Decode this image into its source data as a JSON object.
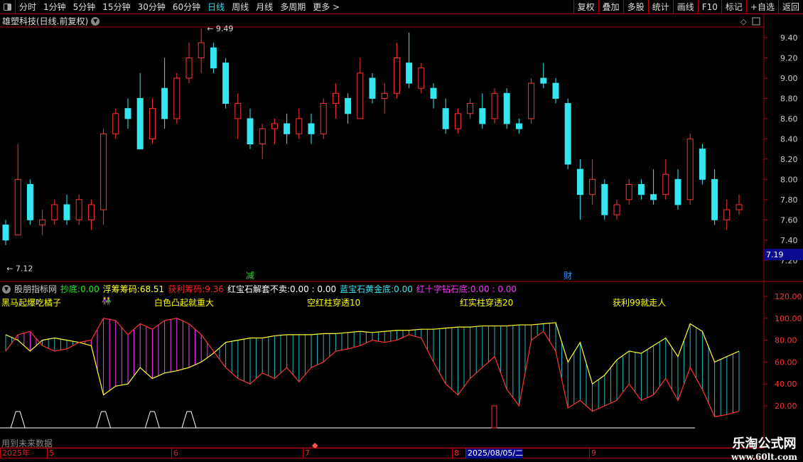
{
  "toolbar": {
    "periods": [
      "分时",
      "1分钟",
      "5分钟",
      "15分钟",
      "30分钟",
      "60分钟",
      "日线",
      "周线",
      "月线",
      "多周期",
      "更多 >"
    ],
    "active": "日线",
    "buttons": [
      "复权",
      "叠加",
      "多股",
      "统计",
      "画线",
      "F10",
      "标记",
      "+自选",
      "返回"
    ]
  },
  "title": "雄塑科技(日线.前复权)",
  "price_axis": {
    "ticks": [
      "9.40",
      "9.20",
      "9.00",
      "8.80",
      "8.60",
      "8.40",
      "8.20",
      "8.00",
      "7.80",
      "7.60",
      "7.40",
      "7.20"
    ],
    "current": "7.19",
    "high_label": "9.49",
    "low_label": "7.12"
  },
  "markers": [
    {
      "text": "减",
      "color": "#22dd22",
      "bar": 20
    },
    {
      "text": "财",
      "color": "#3399ff",
      "bar": 46
    }
  ],
  "colors": {
    "up": "#ff3333",
    "down": "#33e6f0",
    "yellow": "#ffff33",
    "magenta": "#ff33ff",
    "grid_border": "#b00000"
  },
  "candles": [
    [
      7.55,
      7.6,
      7.35,
      7.4
    ],
    [
      7.45,
      8.35,
      7.45,
      8.0
    ],
    [
      7.95,
      8.0,
      7.55,
      7.6
    ],
    [
      7.55,
      7.7,
      7.45,
      7.6
    ],
    [
      7.6,
      7.8,
      7.55,
      7.75
    ],
    [
      7.75,
      7.85,
      7.55,
      7.6
    ],
    [
      7.6,
      7.85,
      7.55,
      7.8
    ],
    [
      7.6,
      7.8,
      7.5,
      7.75
    ],
    [
      7.7,
      8.5,
      7.55,
      8.45
    ],
    [
      8.45,
      8.7,
      8.4,
      8.65
    ],
    [
      8.7,
      8.8,
      8.5,
      8.6
    ],
    [
      8.8,
      9.05,
      8.3,
      8.3
    ],
    [
      8.4,
      8.8,
      8.35,
      8.7
    ],
    [
      8.9,
      9.2,
      8.5,
      8.6
    ],
    [
      8.6,
      9.05,
      8.55,
      9.0
    ],
    [
      9.0,
      9.35,
      8.95,
      9.2
    ],
    [
      9.2,
      9.49,
      9.05,
      9.35
    ],
    [
      9.3,
      9.35,
      9.05,
      9.1
    ],
    [
      9.15,
      9.2,
      8.7,
      8.75
    ],
    [
      8.6,
      8.85,
      8.4,
      8.75
    ],
    [
      8.6,
      8.7,
      8.3,
      8.35
    ],
    [
      8.35,
      8.55,
      8.2,
      8.5
    ],
    [
      8.5,
      8.6,
      8.35,
      8.55
    ],
    [
      8.55,
      8.65,
      8.35,
      8.45
    ],
    [
      8.45,
      8.7,
      8.4,
      8.6
    ],
    [
      8.55,
      8.65,
      8.35,
      8.45
    ],
    [
      8.45,
      8.8,
      8.4,
      8.75
    ],
    [
      8.75,
      8.95,
      8.6,
      8.85
    ],
    [
      8.8,
      8.85,
      8.55,
      8.65
    ],
    [
      8.6,
      9.2,
      8.6,
      9.05
    ],
    [
      9.0,
      9.05,
      8.75,
      8.8
    ],
    [
      8.8,
      8.95,
      8.65,
      8.85
    ],
    [
      8.85,
      9.35,
      8.8,
      9.2
    ],
    [
      9.15,
      9.45,
      8.9,
      8.95
    ],
    [
      8.9,
      9.15,
      8.85,
      9.1
    ],
    [
      8.9,
      8.95,
      8.7,
      8.8
    ],
    [
      8.7,
      8.8,
      8.45,
      8.5
    ],
    [
      8.5,
      8.7,
      8.45,
      8.65
    ],
    [
      8.65,
      8.8,
      8.6,
      8.75
    ],
    [
      8.7,
      8.85,
      8.5,
      8.55
    ],
    [
      8.6,
      8.9,
      8.55,
      8.85
    ],
    [
      8.85,
      8.9,
      8.5,
      8.55
    ],
    [
      8.55,
      8.6,
      8.45,
      8.5
    ],
    [
      8.6,
      9.0,
      8.55,
      8.95
    ],
    [
      9.0,
      9.15,
      8.9,
      8.95
    ],
    [
      8.95,
      9.0,
      8.75,
      8.8
    ],
    [
      8.75,
      8.8,
      8.1,
      8.15
    ],
    [
      8.1,
      8.2,
      7.6,
      7.85
    ],
    [
      7.85,
      8.2,
      7.75,
      8.0
    ],
    [
      7.95,
      8.0,
      7.6,
      7.65
    ],
    [
      7.65,
      7.8,
      7.6,
      7.75
    ],
    [
      7.8,
      8.0,
      7.75,
      7.95
    ],
    [
      7.95,
      8.0,
      7.8,
      7.85
    ],
    [
      7.85,
      8.1,
      7.75,
      7.8
    ],
    [
      7.85,
      8.2,
      7.8,
      8.05
    ],
    [
      8.0,
      8.1,
      7.7,
      7.75
    ],
    [
      7.8,
      8.45,
      7.75,
      8.4
    ],
    [
      8.3,
      8.35,
      7.95,
      8.0
    ],
    [
      8.0,
      8.1,
      7.55,
      7.6
    ],
    [
      7.6,
      7.8,
      7.5,
      7.7
    ],
    [
      7.7,
      7.85,
      7.65,
      7.75
    ]
  ],
  "indicator": {
    "name": "股朋指标网",
    "values": [
      {
        "label": "抄底:",
        "value": "0.00",
        "color": "#22ee22"
      },
      {
        "label": "浮筹筹码:",
        "value": "68.51",
        "color": "#ffff33"
      },
      {
        "label": "获利筹码:",
        "value": "9.36",
        "color": "#ff2222"
      },
      {
        "label": "红宝石解套不卖:",
        "value": "0.00 : 0.00",
        "color": "#ffffff"
      },
      {
        "label": "蓝宝石黄金底:",
        "value": "0.00",
        "color": "#33e6f0"
      },
      {
        "label": "红十字钻石底:",
        "value": "0.00 : 0.00",
        "color": "#ff33ff"
      }
    ],
    "labels": [
      "黑马起爆吃橘子",
      "白色凸起就重大",
      "空红柱穿透10",
      "红实柱穿透20",
      "获利99就走人"
    ],
    "axis_ticks": [
      "120.00",
      "100.00",
      "80.00",
      "60.00",
      "40.00",
      "20.00"
    ],
    "yellow": [
      85,
      80,
      70,
      80,
      82,
      80,
      78,
      75,
      30,
      38,
      40,
      55,
      45,
      50,
      52,
      55,
      60,
      68,
      78,
      80,
      82,
      82,
      84,
      85,
      85,
      85,
      86,
      86,
      87,
      88,
      87,
      88,
      89,
      89,
      90,
      90,
      91,
      92,
      92,
      93,
      93,
      93,
      94,
      94,
      95,
      96,
      60,
      78,
      40,
      48,
      62,
      70,
      68,
      75,
      82,
      65,
      95,
      88,
      60,
      65,
      70
    ],
    "red": [
      70,
      85,
      88,
      75,
      70,
      72,
      78,
      80,
      100,
      98,
      85,
      95,
      90,
      98,
      100,
      95,
      85,
      70,
      55,
      45,
      40,
      50,
      45,
      55,
      42,
      55,
      60,
      70,
      72,
      75,
      80,
      78,
      80,
      85,
      82,
      60,
      40,
      30,
      45,
      55,
      65,
      35,
      20,
      80,
      88,
      70,
      18,
      25,
      15,
      20,
      25,
      40,
      25,
      30,
      45,
      25,
      55,
      35,
      10,
      12,
      15
    ],
    "signals": [
      1,
      8,
      12,
      15
    ],
    "red_bar_index": 40
  },
  "footer": {
    "future_note": "用到未来数据",
    "dates": [
      "2025年",
      "5",
      "6",
      "7",
      "8",
      "2025/08/05/二",
      "9"
    ]
  },
  "watermark": {
    "line1": "乐淘公式网",
    "line2": "www.60lt.com"
  }
}
